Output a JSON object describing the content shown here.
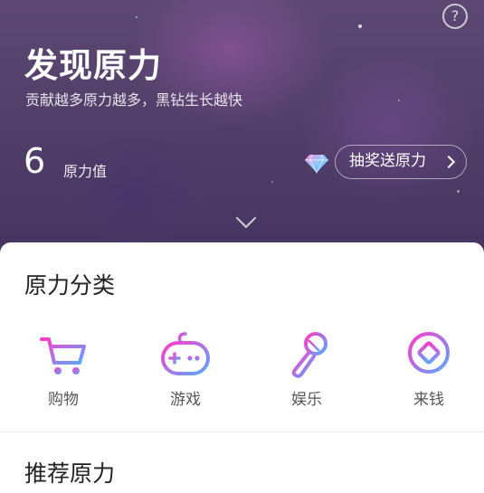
{
  "header": {
    "title": "发现原力",
    "subtitle": "贡献越多原力越多，黑钻生长越快",
    "help_icon": "?"
  },
  "force": {
    "value": "6",
    "label": "原力值"
  },
  "lottery": {
    "label": "抽奖送原力"
  },
  "categories": {
    "title": "原力分类",
    "items": [
      {
        "label": "购物",
        "icon": "cart-icon"
      },
      {
        "label": "游戏",
        "icon": "gamepad-icon"
      },
      {
        "label": "娱乐",
        "icon": "microphone-icon"
      },
      {
        "label": "来钱",
        "icon": "coin-icon"
      }
    ]
  },
  "recommended": {
    "title": "推荐原力"
  },
  "colors": {
    "hero_background": "#54416c",
    "icon_gradient_start": "#ff3cc8",
    "icon_gradient_end": "#5aa8ff"
  }
}
